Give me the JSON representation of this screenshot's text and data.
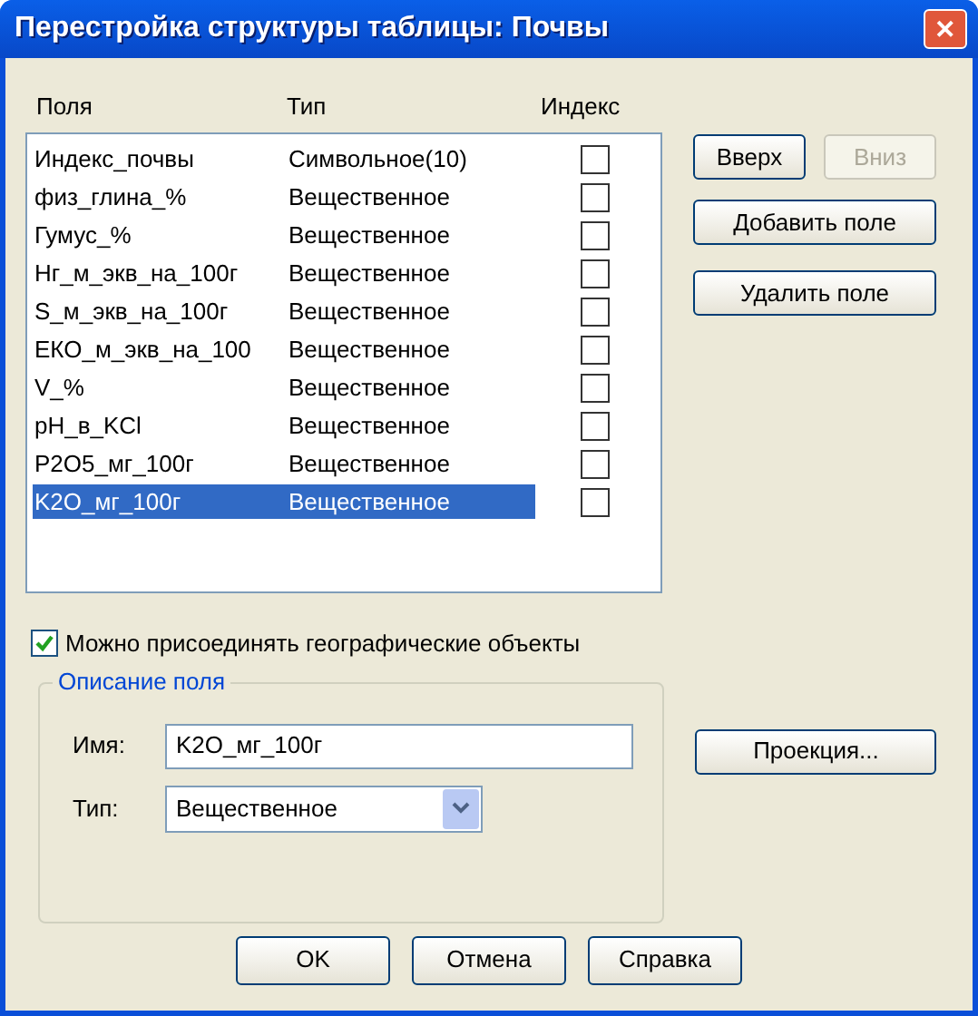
{
  "window": {
    "title": "Перестройка структуры таблицы: Почвы",
    "close": "✕"
  },
  "columns": [
    "Поля",
    "Тип",
    "Индекс"
  ],
  "rows": [
    {
      "name": "Индекс_почвы",
      "type": "Символьное(10)",
      "indexed": false,
      "selected": false
    },
    {
      "name": "физ_глина_%",
      "type": "Вещественное",
      "indexed": false,
      "selected": false
    },
    {
      "name": "Гумус_%",
      "type": "Вещественное",
      "indexed": false,
      "selected": false
    },
    {
      "name": "Нг_м_экв_на_100г",
      "type": "Вещественное",
      "indexed": false,
      "selected": false
    },
    {
      "name": "S_м_экв_на_100г",
      "type": "Вещественное",
      "indexed": false,
      "selected": false
    },
    {
      "name": "ЕКО_м_экв_на_100",
      "type": "Вещественное",
      "indexed": false,
      "selected": false
    },
    {
      "name": "V_%",
      "type": "Вещественное",
      "indexed": false,
      "selected": false
    },
    {
      "name": "pH_в_KCl",
      "type": "Вещественное",
      "indexed": false,
      "selected": false
    },
    {
      "name": "P2O5_мг_100г",
      "type": "Вещественное",
      "indexed": false,
      "selected": false
    },
    {
      "name": "K2O_мг_100г",
      "type": "Вещественное",
      "indexed": false,
      "selected": true
    }
  ],
  "side_buttons": [
    {
      "label": "Вверх",
      "disabled": false
    },
    {
      "label": "Вниз",
      "disabled": true
    },
    {
      "label": "Добавить поле",
      "disabled": false
    },
    {
      "label": "Удалить поле",
      "disabled": false
    }
  ],
  "attach_geo": {
    "label": "Можно присоединять географические объекты",
    "checked": true
  },
  "field_group": {
    "legend": "Описание поля",
    "name_label": "Имя:",
    "name_value": "K2O_мг_100г",
    "type_label": "Тип:",
    "type_value": "Вещественное"
  },
  "projection_button": "Проекция...",
  "buttons": [
    "OK",
    "Отмена",
    "Справка"
  ]
}
